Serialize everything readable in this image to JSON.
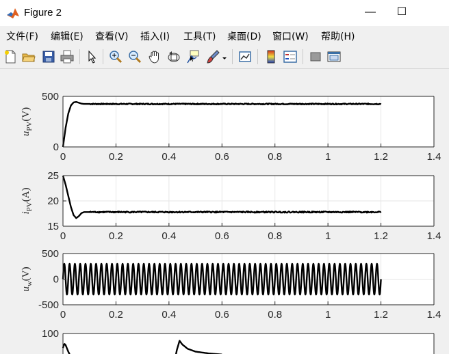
{
  "window": {
    "title": "Figure 2",
    "minimize": "—",
    "maximize": "☐"
  },
  "menu": [
    "文件(F)",
    "编辑(E)",
    "查看(V)",
    "插入(I)",
    "工具(T)",
    "桌面(D)",
    "窗口(W)",
    "帮助(H)"
  ],
  "toolbar": [
    "new-figure-icon",
    "open-file-icon",
    "save-icon",
    "print-icon",
    "pointer-icon",
    "zoom-in-icon",
    "zoom-out-icon",
    "pan-hand-icon",
    "rotate-3d-icon",
    "data-cursor-icon",
    "brush-icon",
    "brush-dropdown-icon",
    "link-plot-icon",
    "colorbar-icon",
    "legend-icon",
    "hide-plot-tools-icon",
    "show-plot-tools-icon"
  ],
  "chart_data": [
    {
      "type": "line",
      "ylabel": {
        "sym": "u",
        "sub": "PV",
        "unit": "(V)"
      },
      "xlim": [
        0,
        1.4
      ],
      "ylim": [
        0,
        500
      ],
      "xticks": [
        "0",
        "0.2",
        "0.4",
        "0.6",
        "0.8",
        "1",
        "1.2",
        "1.4"
      ],
      "yticks": [
        "0",
        "500"
      ],
      "grid": true,
      "x": [
        0,
        0.01,
        0.02,
        0.03,
        0.04,
        0.05,
        0.06,
        0.07,
        0.08,
        0.1,
        0.2,
        0.4,
        0.6,
        0.8,
        1.0,
        1.2
      ],
      "y": [
        0,
        190,
        330,
        410,
        440,
        445,
        437,
        428,
        425,
        425,
        425,
        425,
        425,
        425,
        425,
        425
      ],
      "ripple": 5
    },
    {
      "type": "line",
      "ylabel": {
        "sym": "i",
        "sub": "PV",
        "unit": "(A)"
      },
      "xlim": [
        0,
        1.4
      ],
      "ylim": [
        15,
        25
      ],
      "xticks": [
        "0",
        "0.2",
        "0.4",
        "0.6",
        "0.8",
        "1",
        "1.2",
        "1.4"
      ],
      "yticks": [
        "15",
        "20",
        "25"
      ],
      "grid": true,
      "x": [
        0,
        0.01,
        0.02,
        0.03,
        0.04,
        0.05,
        0.06,
        0.07,
        0.08,
        0.1,
        0.2,
        0.4,
        0.6,
        0.8,
        1.0,
        1.2
      ],
      "y": [
        25,
        23.2,
        21.0,
        18.8,
        17.2,
        16.6,
        17.0,
        17.6,
        17.8,
        17.8,
        17.8,
        17.8,
        17.8,
        17.8,
        17.8,
        17.8
      ],
      "ripple": 0.12
    },
    {
      "type": "line",
      "ylabel": {
        "sym": "u",
        "sub": "w",
        "unit": "(V)"
      },
      "xlim": [
        0,
        1.4
      ],
      "ylim": [
        -500,
        500
      ],
      "xticks": [
        "0",
        "0.2",
        "0.4",
        "0.6",
        "0.8",
        "1",
        "1.2",
        "1.4"
      ],
      "yticks": [
        "-500",
        "0",
        "500"
      ],
      "grid": true,
      "sine": {
        "amplitude": 300,
        "frequency": 50,
        "start": 0,
        "end": 1.2
      }
    },
    {
      "type": "line",
      "xlim": [
        0,
        1.4
      ],
      "ylim": [
        0,
        100
      ],
      "yticks": [
        "100"
      ],
      "grid": true,
      "x": [
        0,
        0.005,
        0.01,
        0.02,
        0.03,
        0.04,
        0.42,
        0.43,
        0.44,
        0.45,
        0.47,
        0.5,
        0.55,
        0.6
      ],
      "y": [
        60,
        72,
        68,
        50,
        35,
        20,
        20,
        55,
        80,
        70,
        58,
        50,
        45,
        42
      ]
    }
  ]
}
